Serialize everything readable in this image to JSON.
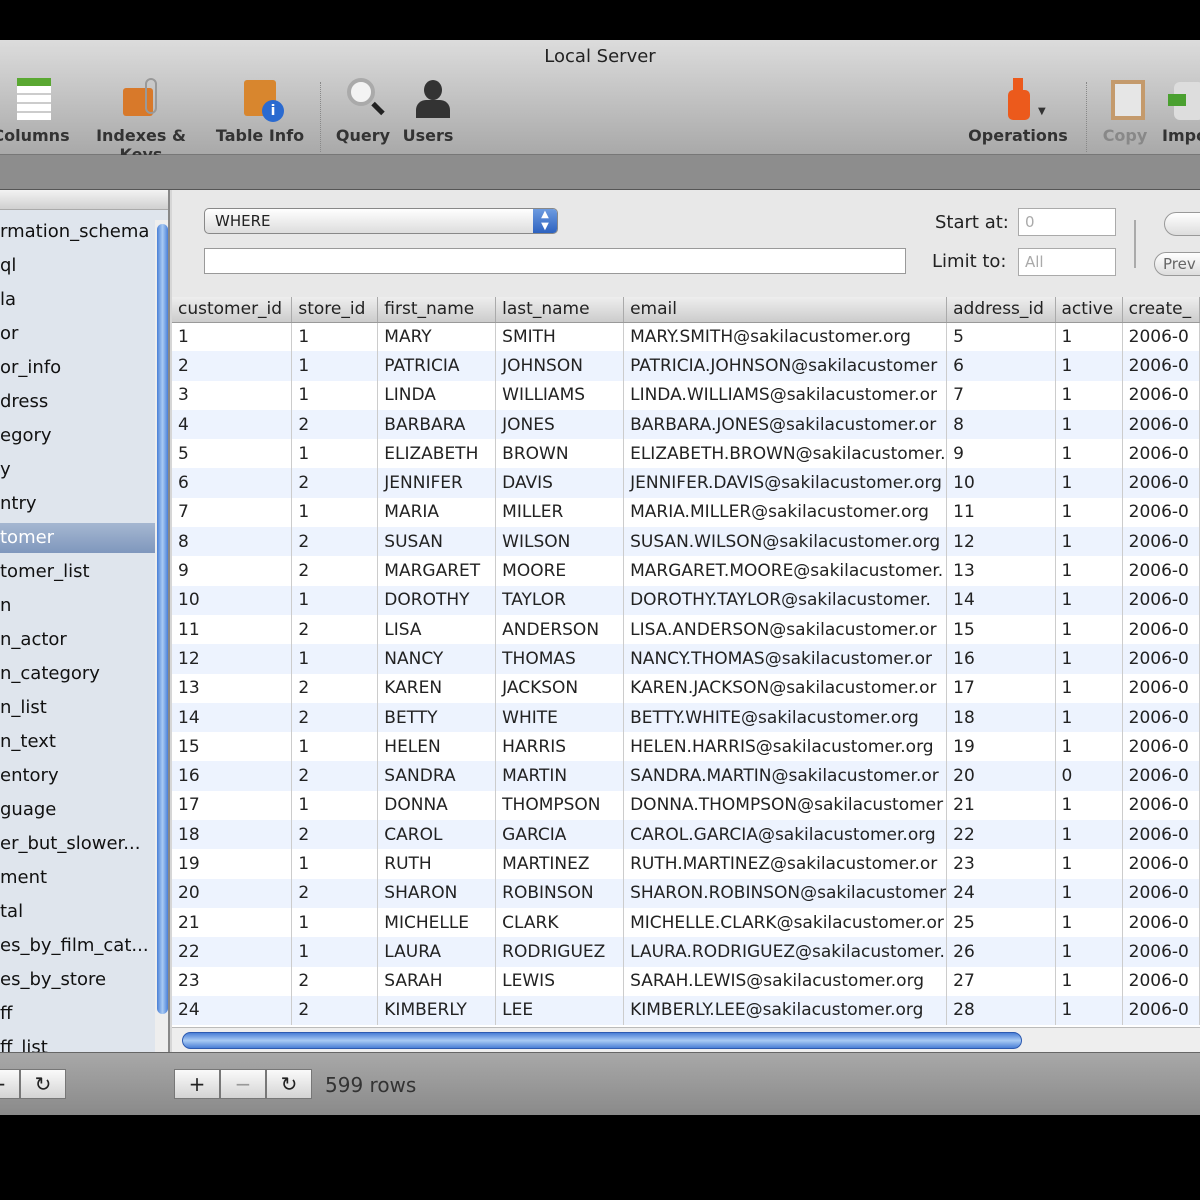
{
  "window": {
    "title": "Local Server"
  },
  "toolbar": {
    "items": [
      {
        "label": "Columns",
        "icon": "columns-icon"
      },
      {
        "label": "Indexes & Keys",
        "icon": "indexes-keys-icon"
      },
      {
        "label": "Table Info",
        "icon": "table-info-icon"
      },
      {
        "label": "Query",
        "icon": "query-icon"
      },
      {
        "label": "Users",
        "icon": "users-icon"
      },
      {
        "label": "Operations",
        "icon": "operations-icon"
      },
      {
        "label": "Copy",
        "icon": "copy-icon"
      },
      {
        "label": "Impo",
        "icon": "import-icon"
      }
    ]
  },
  "sidebar": {
    "items": [
      "rmation_schema",
      "ql",
      "la",
      "or",
      "or_info",
      "dress",
      "egory",
      "y",
      "ntry",
      "tomer",
      "tomer_list",
      "n",
      "n_actor",
      "n_category",
      "n_list",
      "n_text",
      "entory",
      "guage",
      "er_but_slower...",
      "ment",
      "tal",
      "es_by_film_cat...",
      "es_by_store",
      "ff",
      "ff_list"
    ],
    "selected_index": 9
  },
  "filter": {
    "where_label": "WHERE",
    "filter_value": "",
    "start_at_label": "Start at:",
    "start_at_value": "0",
    "limit_label": "Limit to:",
    "limit_value": "All",
    "prev_label": "Prev"
  },
  "table": {
    "columns": [
      "customer_id",
      "store_id",
      "first_name",
      "last_name",
      "email",
      "address_id",
      "active",
      "create_"
    ],
    "rows": [
      [
        "1",
        "1",
        "MARY",
        "SMITH",
        "MARY.SMITH@sakilacustomer.org",
        "5",
        "1",
        "2006-0"
      ],
      [
        "2",
        "1",
        "PATRICIA",
        "JOHNSON",
        "PATRICIA.JOHNSON@sakilacustomer",
        "6",
        "1",
        "2006-0"
      ],
      [
        "3",
        "1",
        "LINDA",
        "WILLIAMS",
        "LINDA.WILLIAMS@sakilacustomer.or",
        "7",
        "1",
        "2006-0"
      ],
      [
        "4",
        "2",
        "BARBARA",
        "JONES",
        "BARBARA.JONES@sakilacustomer.or",
        "8",
        "1",
        "2006-0"
      ],
      [
        "5",
        "1",
        "ELIZABETH",
        "BROWN",
        "ELIZABETH.BROWN@sakilacustomer.",
        "9",
        "1",
        "2006-0"
      ],
      [
        "6",
        "2",
        "JENNIFER",
        "DAVIS",
        "JENNIFER.DAVIS@sakilacustomer.org",
        "10",
        "1",
        "2006-0"
      ],
      [
        "7",
        "1",
        "MARIA",
        "MILLER",
        "MARIA.MILLER@sakilacustomer.org",
        "11",
        "1",
        "2006-0"
      ],
      [
        "8",
        "2",
        "SUSAN",
        "WILSON",
        "SUSAN.WILSON@sakilacustomer.org",
        "12",
        "1",
        "2006-0"
      ],
      [
        "9",
        "2",
        "MARGARET",
        "MOORE",
        "MARGARET.MOORE@sakilacustomer.",
        "13",
        "1",
        "2006-0"
      ],
      [
        "10",
        "1",
        "DOROTHY",
        "TAYLOR",
        "DOROTHY.TAYLOR@sakilacustomer.",
        "14",
        "1",
        "2006-0"
      ],
      [
        "11",
        "2",
        "LISA",
        "ANDERSON",
        "LISA.ANDERSON@sakilacustomer.or",
        "15",
        "1",
        "2006-0"
      ],
      [
        "12",
        "1",
        "NANCY",
        "THOMAS",
        "NANCY.THOMAS@sakilacustomer.or",
        "16",
        "1",
        "2006-0"
      ],
      [
        "13",
        "2",
        "KAREN",
        "JACKSON",
        "KAREN.JACKSON@sakilacustomer.or",
        "17",
        "1",
        "2006-0"
      ],
      [
        "14",
        "2",
        "BETTY",
        "WHITE",
        "BETTY.WHITE@sakilacustomer.org",
        "18",
        "1",
        "2006-0"
      ],
      [
        "15",
        "1",
        "HELEN",
        "HARRIS",
        "HELEN.HARRIS@sakilacustomer.org",
        "19",
        "1",
        "2006-0"
      ],
      [
        "16",
        "2",
        "SANDRA",
        "MARTIN",
        "SANDRA.MARTIN@sakilacustomer.or",
        "20",
        "0",
        "2006-0"
      ],
      [
        "17",
        "1",
        "DONNA",
        "THOMPSON",
        "DONNA.THOMPSON@sakilacustomer",
        "21",
        "1",
        "2006-0"
      ],
      [
        "18",
        "2",
        "CAROL",
        "GARCIA",
        "CAROL.GARCIA@sakilacustomer.org",
        "22",
        "1",
        "2006-0"
      ],
      [
        "19",
        "1",
        "RUTH",
        "MARTINEZ",
        "RUTH.MARTINEZ@sakilacustomer.or",
        "23",
        "1",
        "2006-0"
      ],
      [
        "20",
        "2",
        "SHARON",
        "ROBINSON",
        "SHARON.ROBINSON@sakilacustomer",
        "24",
        "1",
        "2006-0"
      ],
      [
        "21",
        "1",
        "MICHELLE",
        "CLARK",
        "MICHELLE.CLARK@sakilacustomer.or",
        "25",
        "1",
        "2006-0"
      ],
      [
        "22",
        "1",
        "LAURA",
        "RODRIGUEZ",
        "LAURA.RODRIGUEZ@sakilacustomer.",
        "26",
        "1",
        "2006-0"
      ],
      [
        "23",
        "2",
        "SARAH",
        "LEWIS",
        "SARAH.LEWIS@sakilacustomer.org",
        "27",
        "1",
        "2006-0"
      ],
      [
        "24",
        "2",
        "KIMBERLY",
        "LEE",
        "KIMBERLY.LEE@sakilacustomer.org",
        "28",
        "1",
        "2006-0"
      ]
    ]
  },
  "footer": {
    "add": "+",
    "remove": "−",
    "refresh": "↻",
    "row_count": "599 rows"
  }
}
